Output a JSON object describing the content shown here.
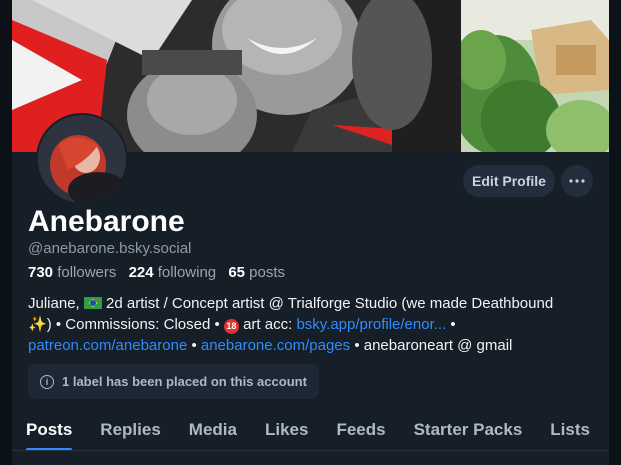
{
  "profile": {
    "display_name": "Anebarone",
    "handle": "@anebarone.bsky.social",
    "followers_count": "730",
    "followers_label": "followers",
    "following_count": "224",
    "following_label": "following",
    "posts_count": "65",
    "posts_label": "posts"
  },
  "actions": {
    "edit_label": "Edit Profile",
    "more_icon": "ellipsis-icon"
  },
  "bio": {
    "line1_a": "Juliane, ",
    "line1_b": " 2d artist / Concept artist @ Trialforge Studio (we made Deathbound",
    "line2_a": ") • Commissions: Closed • ",
    "line2_b": " art acc: ",
    "link1": "bsky.app/profile/enor...",
    "line2_c": " •",
    "link2": "patreon.com/anebarone",
    "sep": " • ",
    "link3": "anebarone.com/pages",
    "line3_tail": " • anebaroneart @ gmail",
    "nsfw_badge": "18"
  },
  "label_notice": {
    "text": "1 label has been placed on this account"
  },
  "tabs": [
    {
      "label": "Posts"
    },
    {
      "label": "Replies"
    },
    {
      "label": "Media"
    },
    {
      "label": "Likes"
    },
    {
      "label": "Feeds"
    },
    {
      "label": "Starter Packs"
    },
    {
      "label": "Lists"
    }
  ],
  "colors": {
    "background": "#161e27",
    "accent": "#2f8cff",
    "button_bg": "#232e3c",
    "muted_text": "#8f9aa8"
  }
}
